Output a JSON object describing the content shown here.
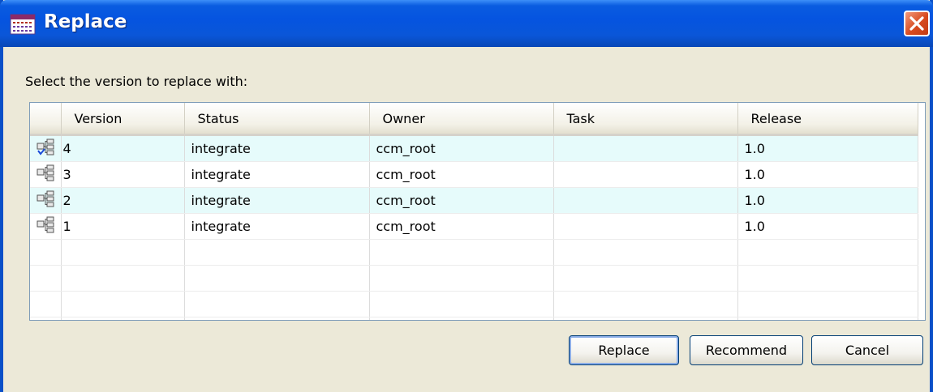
{
  "window": {
    "title": "Replace"
  },
  "dialog": {
    "prompt": "Select the version to replace with:"
  },
  "table": {
    "columns": [
      "Version",
      "Status",
      "Owner",
      "Task",
      "Release"
    ],
    "rows": [
      {
        "version": "4",
        "status": "integrate",
        "owner": "ccm_root",
        "task": "",
        "release": "1.0",
        "icon": "version-checked-icon"
      },
      {
        "version": "3",
        "status": "integrate",
        "owner": "ccm_root",
        "task": "",
        "release": "1.0",
        "icon": "version-icon"
      },
      {
        "version": "2",
        "status": "integrate",
        "owner": "ccm_root",
        "task": "",
        "release": "1.0",
        "icon": "version-icon"
      },
      {
        "version": "1",
        "status": "integrate",
        "owner": "ccm_root",
        "task": "",
        "release": "1.0",
        "icon": "version-icon"
      }
    ]
  },
  "buttons": {
    "replace": "Replace",
    "recommend": "Recommend",
    "cancel": "Cancel"
  },
  "colors": {
    "titlebar": "#0554e0",
    "row_highlight": "#e6fbfb",
    "close": "#d74a1f"
  }
}
